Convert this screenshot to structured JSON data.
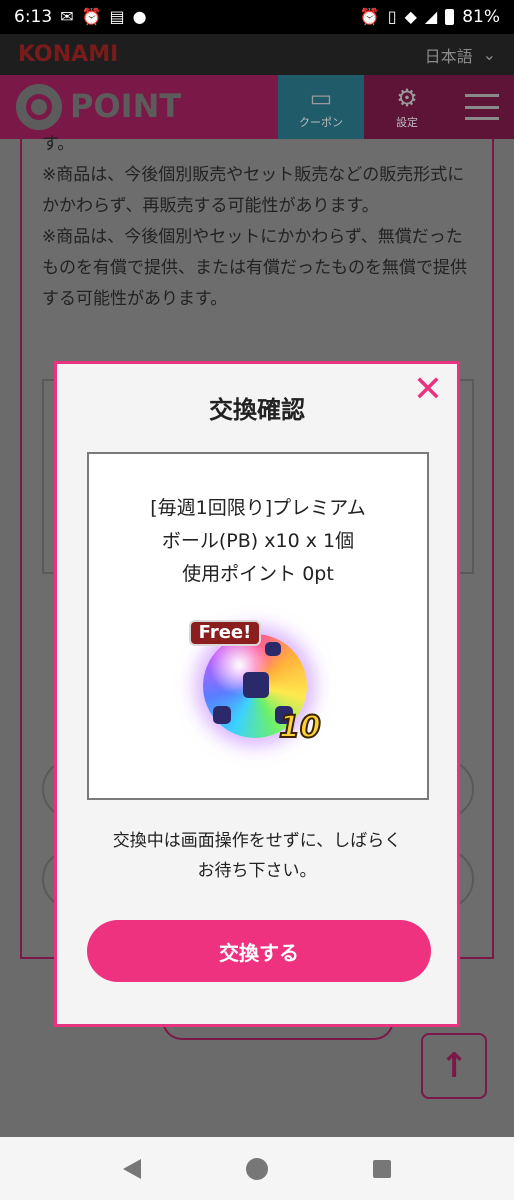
{
  "status_bar": {
    "time": "6:13",
    "battery": "81%"
  },
  "konami_bar": {
    "logo": "KONAMI",
    "language": "日本語"
  },
  "header": {
    "logo_text": "POINT",
    "coupon_label": "クーポン",
    "settings_label": "設定"
  },
  "page": {
    "fragment": "す。",
    "notes": [
      "※商品は、今後個別販売やセット販売などの販売形式にかかわらず、再販売する可能性があります。",
      "※商品は、今後個別やセットにかかわらず、無償だったものを有償で提供、または有償だったものを無償で提供する可能性があります。"
    ]
  },
  "modal": {
    "title": "交換確認",
    "close_symbol": "✕",
    "item_line1": "[毎週1回限り]プレミアム",
    "item_line2": "ボール(PB) x10 x 1個",
    "item_line3": "使用ポイント 0pt",
    "badge_free": "Free!",
    "badge_count": "10",
    "notice_line1": "交換中は画面操作をせずに、しばらく",
    "notice_line2": "お待ち下さい。",
    "exchange_button": "交換する"
  },
  "colors": {
    "accent_pink": "#ee327f",
    "header_maroon": "#7a1947",
    "coupon_teal": "#1f5b69"
  },
  "icons": [
    "mail-icon",
    "alarm-icon",
    "news-icon",
    "safe-icon",
    "vibrate-icon",
    "wifi-icon",
    "signal-icon",
    "battery-icon",
    "ticket-icon",
    "gear-icon",
    "menu-icon",
    "close-icon",
    "arrow-up-icon",
    "back-icon",
    "home-icon",
    "recents-icon"
  ]
}
